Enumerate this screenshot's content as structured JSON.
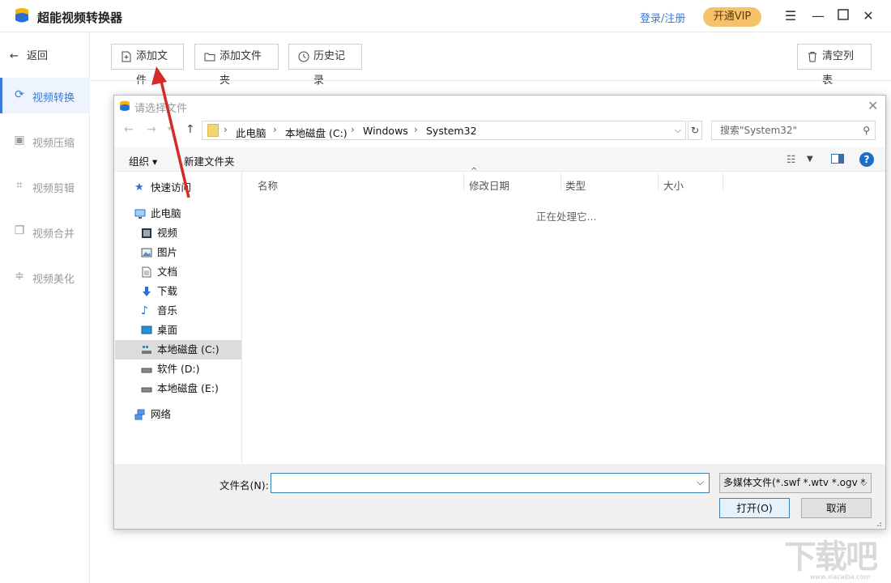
{
  "app": {
    "title": "超能视频转换器",
    "login_label": "登录/注册",
    "vip_label": "开通VIP",
    "accent": "#3a79d8"
  },
  "sidebar": {
    "back_label": "返回",
    "items": [
      {
        "label": "视频转换",
        "icon": "refresh-icon"
      },
      {
        "label": "视频压缩",
        "icon": "compress-icon"
      },
      {
        "label": "视频剪辑",
        "icon": "crop-icon"
      },
      {
        "label": "视频合并",
        "icon": "merge-icon"
      },
      {
        "label": "视频美化",
        "icon": "sliders-icon"
      }
    ]
  },
  "toolbar": {
    "add_file": "添加文件",
    "add_folder": "添加文件夹",
    "history": "历史记录",
    "clear_list": "清空列表"
  },
  "dialog": {
    "title": "请选择文件",
    "breadcrumbs": [
      "此电脑",
      "本地磁盘 (C:)",
      "Windows",
      "System32"
    ],
    "search_placeholder": "搜索\"System32\"",
    "organize_label": "组织 ▾",
    "new_folder_label": "新建文件夹",
    "nav": {
      "quick_access": "快速访问",
      "this_pc": "此电脑",
      "video": "视频",
      "pictures": "图片",
      "documents": "文档",
      "downloads": "下载",
      "music": "音乐",
      "desktop": "桌面",
      "drive_c": "本地磁盘 (C:)",
      "drive_d": "软件 (D:)",
      "drive_e": "本地磁盘 (E:)",
      "network": "网络"
    },
    "columns": [
      "名称",
      "修改日期",
      "类型",
      "大小"
    ],
    "status": "正在处理它...",
    "filename_label": "文件名(N):",
    "filename_value": "",
    "filetype_value": "多媒体文件(*.swf *.wtv *.ogv *",
    "open_label": "打开(O)",
    "cancel_label": "取消"
  },
  "watermark": {
    "text": "下载吧",
    "sub": "www.xiazaiba.com"
  }
}
